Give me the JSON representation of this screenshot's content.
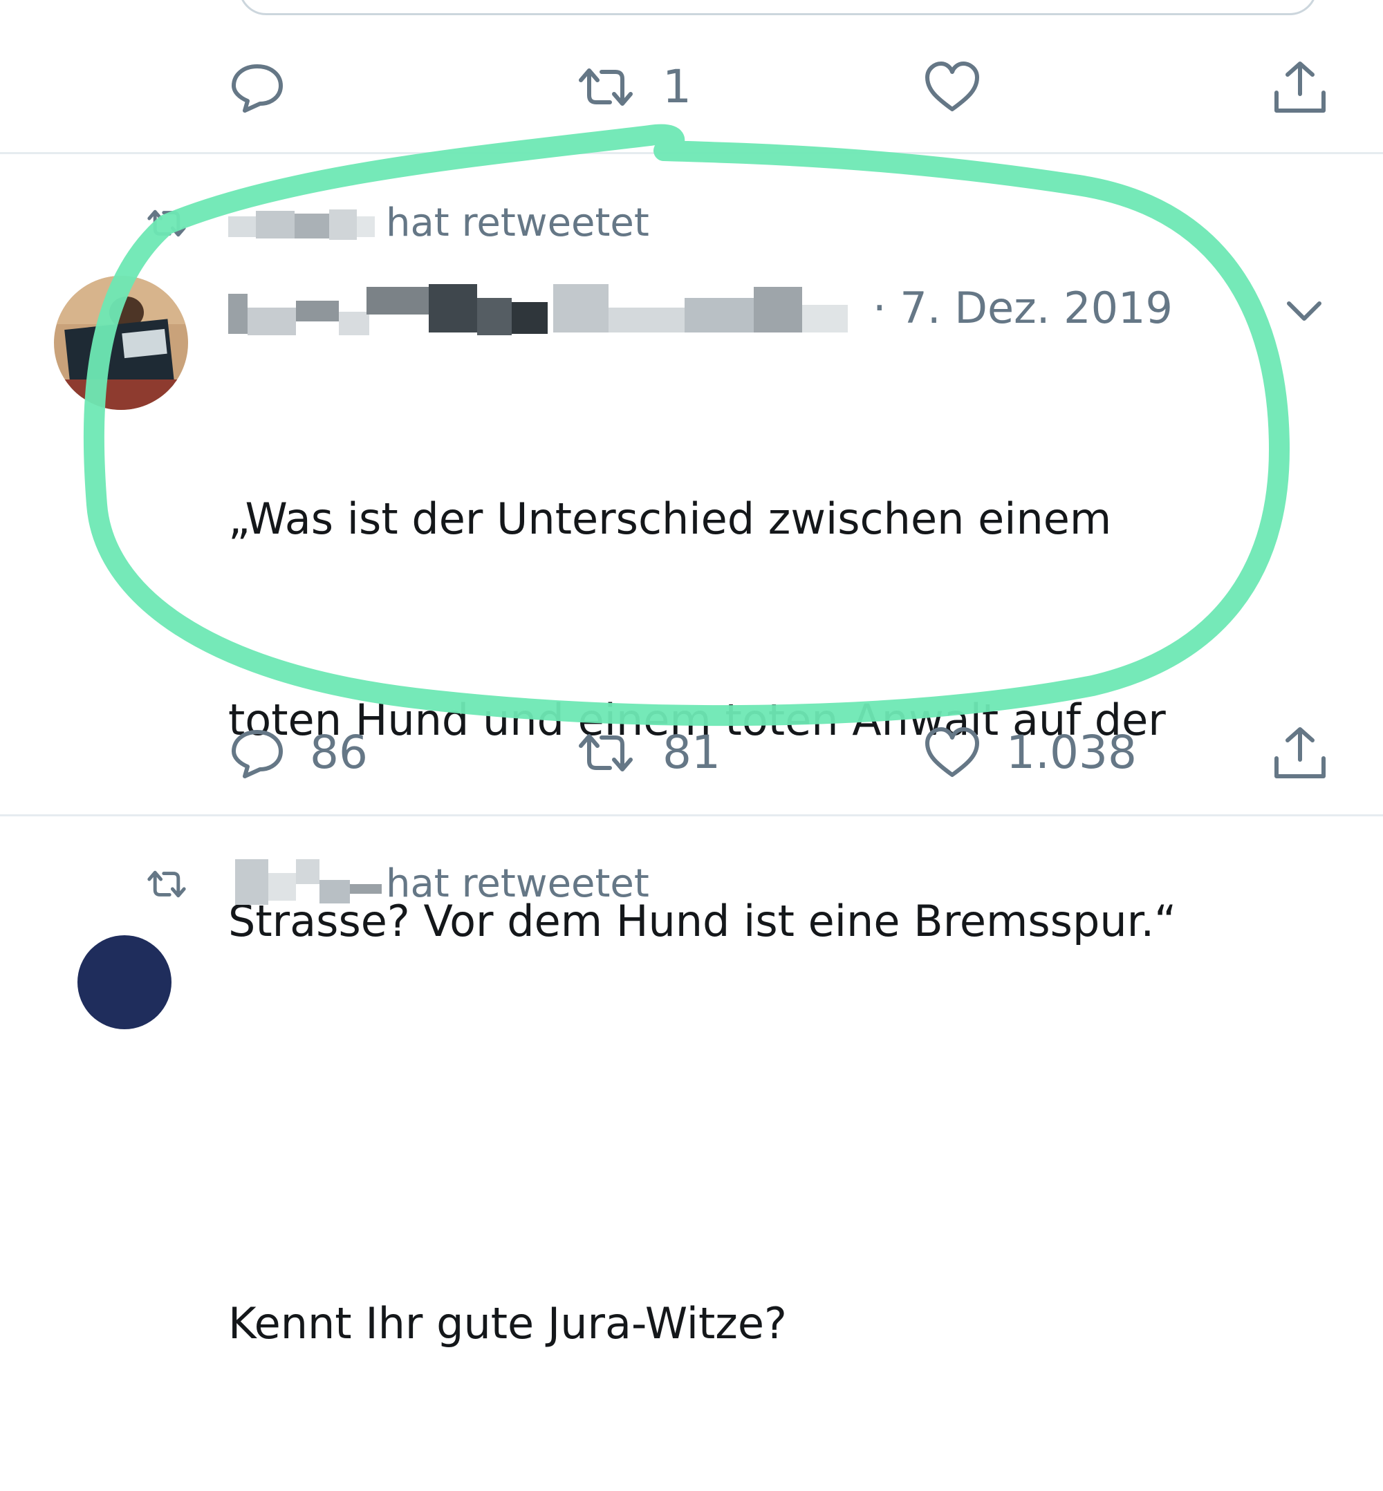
{
  "top_tweet": {
    "actions": {
      "reply_count": "",
      "retweet_count": "1",
      "like_count": ""
    }
  },
  "tweet": {
    "retweet_context": "hat retweetet",
    "date": "· 7. Dez. 2019",
    "text_lines": [
      "„Was ist der Unterschied zwischen einem",
      "toten Hund und einem toten Anwalt auf der",
      "Strasse? Vor dem Hund ist eine Bremsspur.“",
      "",
      "Kennt Ihr gute Jura-Witze?"
    ],
    "actions": {
      "reply_count": "86",
      "retweet_count": "81",
      "like_count": "1.038"
    }
  },
  "next_tweet": {
    "retweet_context": "hat retweetet"
  },
  "colors": {
    "text": "#14171a",
    "muted": "#657786",
    "divider": "#e6ecf0",
    "highlight": "#6ee8b4"
  },
  "icons": [
    "reply-icon",
    "retweet-icon",
    "like-icon",
    "share-icon",
    "chevron-down-icon"
  ]
}
